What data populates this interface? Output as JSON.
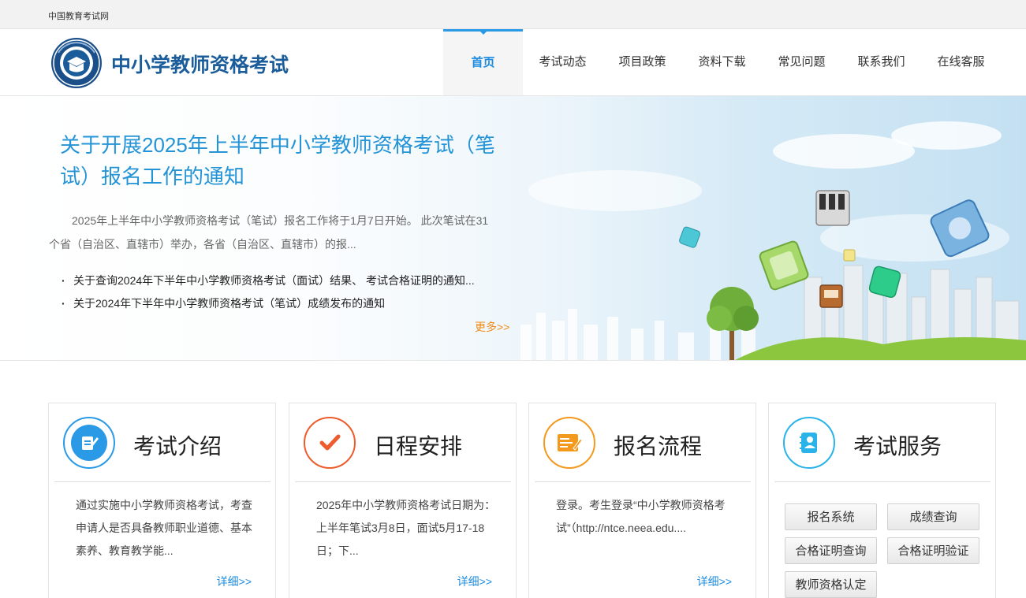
{
  "topbar": {
    "site_name": "中国教育考试网"
  },
  "header": {
    "brand": "中小学教师资格考试"
  },
  "nav": {
    "items": [
      {
        "label": "首页",
        "active": true
      },
      {
        "label": "考试动态"
      },
      {
        "label": "项目政策"
      },
      {
        "label": "资料下载"
      },
      {
        "label": "常见问题"
      },
      {
        "label": "联系我们"
      },
      {
        "label": "在线客服"
      }
    ]
  },
  "banner": {
    "title": "关于开展2025年上半年中小学教师资格考试（笔试）报名工作的通知",
    "desc": "2025年上半年中小学教师资格考试（笔试）报名工作将于1月7日开始。  此次笔试在31个省（自治区、直辖市）举办，各省（自治区、直辖市）的报...",
    "news": [
      "关于查询2024年下半年中小学教师资格考试（面试）结果、 考试合格证明的通知...",
      "关于2024年下半年中小学教师资格考试（笔试）成绩发布的通知"
    ],
    "more": "更多>>"
  },
  "cards": [
    {
      "icon": "pen-document-icon",
      "title": "考试介绍",
      "text": "通过实施中小学教师资格考试，考查申请人是否具备教师职业道德、基本素养、教育教学能...",
      "detail": "详细>>",
      "color": "#2b9ae6"
    },
    {
      "icon": "checkmark-icon",
      "title": "日程安排",
      "text": "2025年中小学教师资格考试日期为：上半年笔试3月8日，面试5月17-18日；下...",
      "detail": "详细>>",
      "color": "#ee5b2c"
    },
    {
      "icon": "registration-form-icon",
      "title": "报名流程",
      "text": "登录。考生登录“中小学教师资格考试”（http://ntce.neea.edu....",
      "detail": "详细>>",
      "color": "#f39a1e"
    },
    {
      "icon": "address-book-icon",
      "title": "考试服务",
      "color": "#2ab3e8"
    }
  ],
  "services": {
    "buttons": [
      "报名系统",
      "成绩查询",
      "合格证明查询",
      "合格证明验证",
      "教师资格认定"
    ]
  },
  "colors": {
    "accent": "#1e8ce0",
    "brand": "#1b5c9a",
    "more": "#f08b17"
  }
}
